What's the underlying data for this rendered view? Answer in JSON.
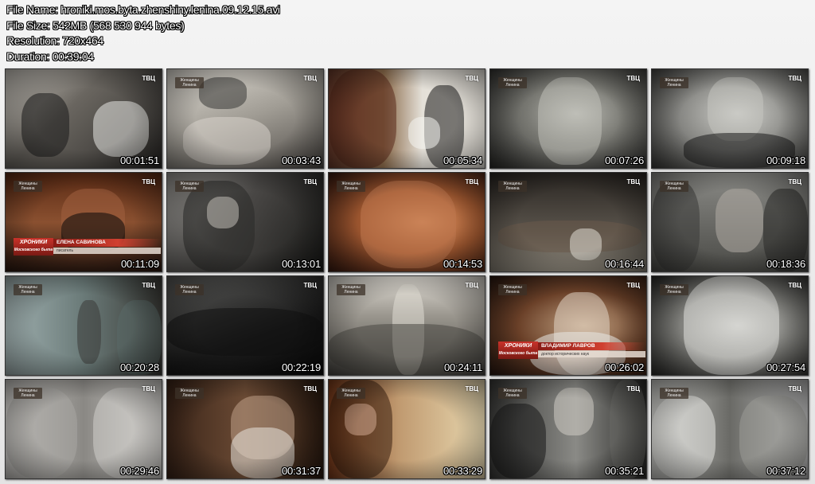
{
  "header": {
    "file_name": "File Name: hroniki.mos.byta.zhenshiny.lenina.09.12.15.avi",
    "file_size": "File Size: 542MB (568 530 944 bytes)",
    "resolution": "Resolution: 720x464",
    "duration": "Duration: 00:39:04"
  },
  "overlay": {
    "channel": "ТВЦ",
    "logo_line1": "Женщины",
    "logo_line2": "Ленина",
    "caption_logo_line1": "ХРОНИКИ",
    "caption_logo_line2": "Московского быта"
  },
  "thumbnails": [
    {
      "time": "00:01:51",
      "bg": "#8a8680"
    },
    {
      "time": "00:03:43",
      "bg": "#a9a59d"
    },
    {
      "time": "00:05:34",
      "bg": "#d9d2c3"
    },
    {
      "time": "00:07:26",
      "bg": "#5e5e5a"
    },
    {
      "time": "00:09:18",
      "bg": "#8e8e8a"
    },
    {
      "time": "00:11:09",
      "bg": "#6a3a22",
      "caption_name": "ЕЛЕНА САВИНОВА",
      "caption_sub": "писатель"
    },
    {
      "time": "00:13:01",
      "bg": "#545250"
    },
    {
      "time": "00:14:53",
      "bg": "#b0683e"
    },
    {
      "time": "00:16:44",
      "bg": "#3e3a34"
    },
    {
      "time": "00:18:36",
      "bg": "#6a6a66"
    },
    {
      "time": "00:20:28",
      "bg": "#7a8a8a"
    },
    {
      "time": "00:22:19",
      "bg": "#2a2a2a"
    },
    {
      "time": "00:24:11",
      "bg": "#8a8884"
    },
    {
      "time": "00:26:02",
      "bg": "#5a3a24",
      "caption_name": "ВЛАДИМИР ЛАВРОВ",
      "caption_sub": "доктор исторических наук"
    },
    {
      "time": "00:27:54",
      "bg": "#7a7a76"
    },
    {
      "time": "00:29:46",
      "bg": "#9a9894"
    },
    {
      "time": "00:31:37",
      "bg": "#4a3020"
    },
    {
      "time": "00:33:29",
      "bg": "#9a4a2a"
    },
    {
      "time": "00:35:21",
      "bg": "#4a4a48"
    },
    {
      "time": "00:37:12",
      "bg": "#8a8a86"
    }
  ]
}
